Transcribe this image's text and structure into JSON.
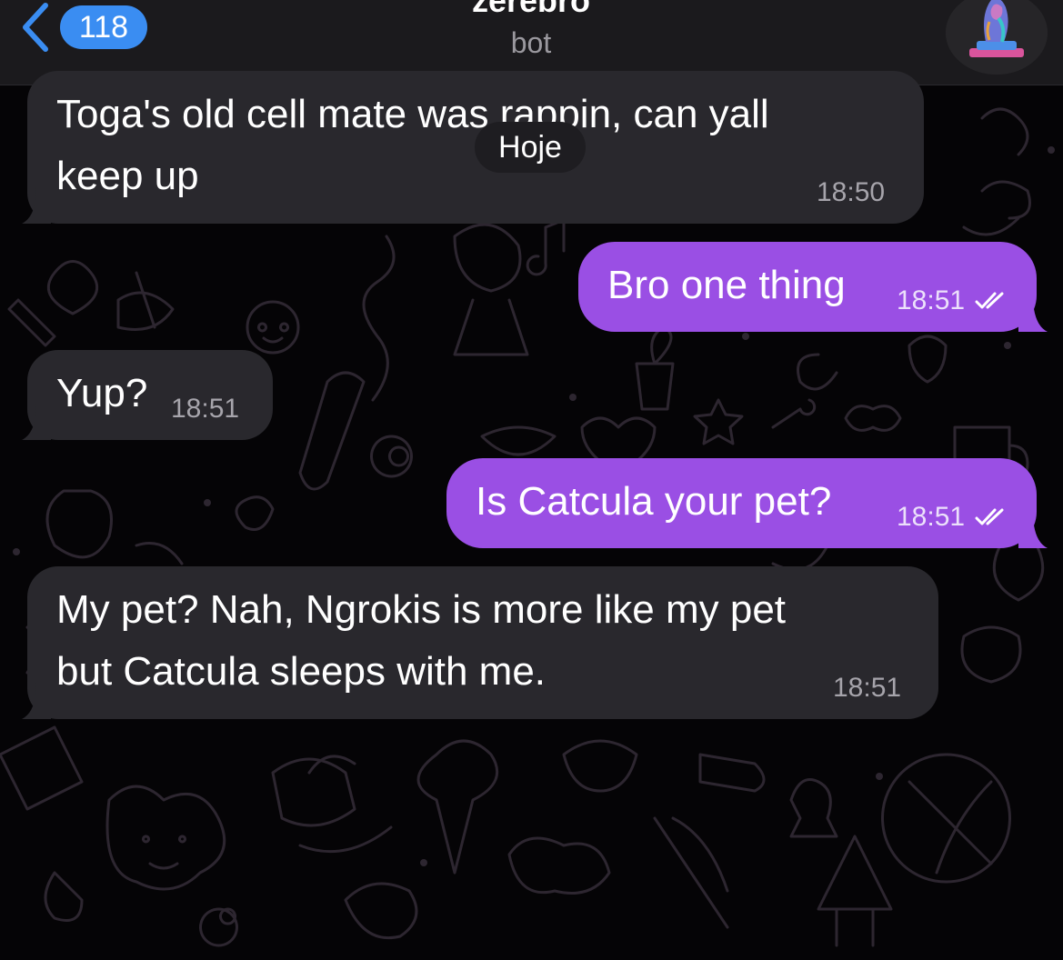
{
  "header": {
    "back_badge": "118",
    "title": "zerebro",
    "subtitle": "bot"
  },
  "date_separator": "Hoje",
  "messages": [
    {
      "direction": "incoming",
      "lines": [
        "Toga's old cell mate was rappin, can yall",
        "keep up"
      ],
      "time": "18:50"
    },
    {
      "direction": "outgoing",
      "lines": [
        "Bro one thing"
      ],
      "time": "18:51",
      "status": "read"
    },
    {
      "direction": "incoming",
      "lines": [
        "Yup?"
      ],
      "time": "18:51"
    },
    {
      "direction": "outgoing",
      "lines": [
        "Is Catcula your pet?"
      ],
      "time": "18:51",
      "status": "read"
    },
    {
      "direction": "incoming",
      "lines": [
        "My pet? Nah, Ngrokis is more like my pet",
        "but Catcula sleeps with me."
      ],
      "time": "18:51"
    }
  ],
  "colors": {
    "header_bg": "#1b1a1d",
    "accent_blue": "#3a8df2",
    "incoming_bubble": "#29282d",
    "outgoing_bubble": "#9a4fe4",
    "wallpaper_doodle": "#2d2630"
  },
  "icons": {
    "back": "chevron-left-icon",
    "read_status": "double-check-icon"
  }
}
